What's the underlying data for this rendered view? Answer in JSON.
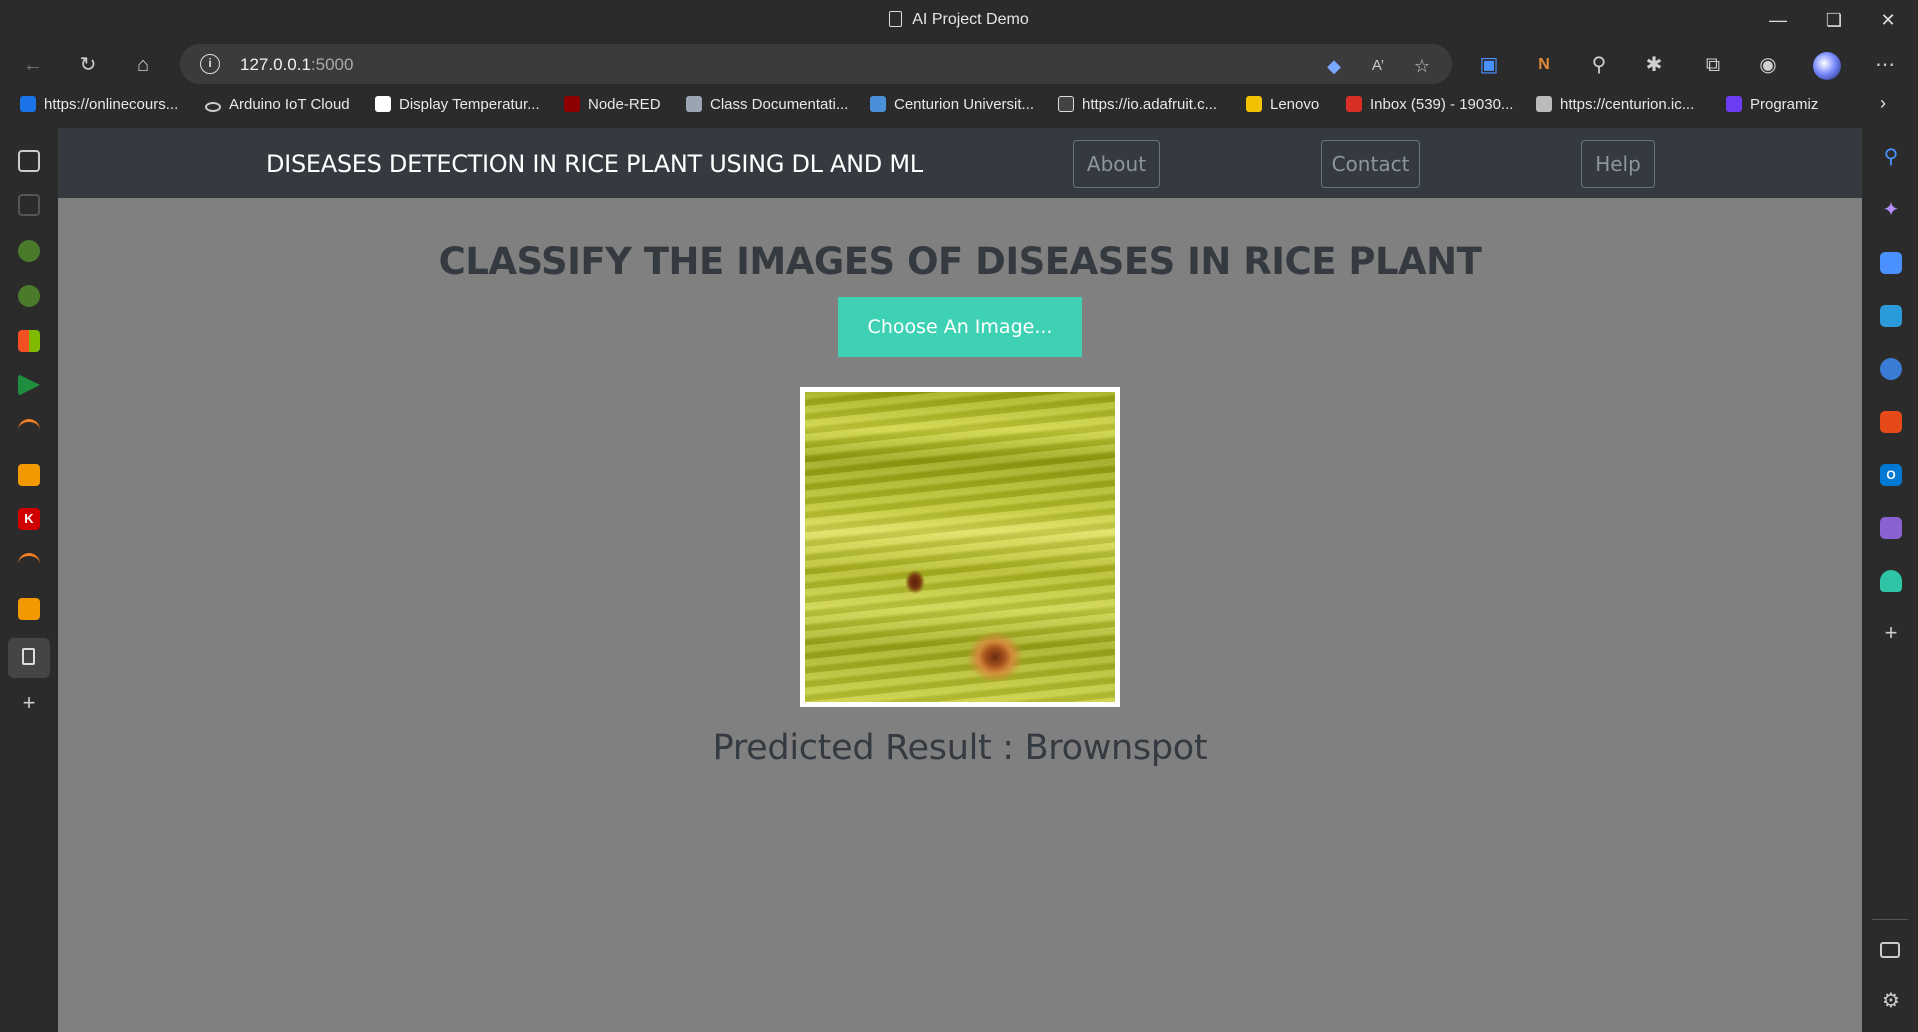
{
  "browser": {
    "window_title": "AI Project Demo",
    "url_host": "127.0.0.1",
    "url_port": ":5000",
    "bookmarks": [
      {
        "label": "https://onlinecours...",
        "color": "#1a73e8"
      },
      {
        "label": "Arduino IoT Cloud",
        "color": "#2b2b2b"
      },
      {
        "label": "Display Temperatur...",
        "color": "#ffffff"
      },
      {
        "label": "Node-RED",
        "color": "#8f0000"
      },
      {
        "label": "Class Documentati...",
        "color": "#9aa4b2"
      },
      {
        "label": "Centurion Universit...",
        "color": "#4a90d9"
      },
      {
        "label": "https://io.adafruit.c...",
        "color": "#222222"
      },
      {
        "label": "Lenovo",
        "color": "#f2c200"
      },
      {
        "label": "Inbox (539) - 19030...",
        "color": "#d93025"
      },
      {
        "label": "https://centurion.ic...",
        "color": "#bbbbbb"
      },
      {
        "label": "Programiz",
        "color": "#6b3df5"
      }
    ]
  },
  "nav": {
    "brand": "DISEASES DETECTION IN RICE PLANT USING DL AND ML",
    "about": "About",
    "contact": "Contact",
    "help": "Help"
  },
  "main": {
    "heading": "CLASSIFY THE IMAGES OF DISEASES IN RICE PLANT",
    "choose_button": "Choose An Image...",
    "result": "Predicted Result : Brownspot"
  }
}
